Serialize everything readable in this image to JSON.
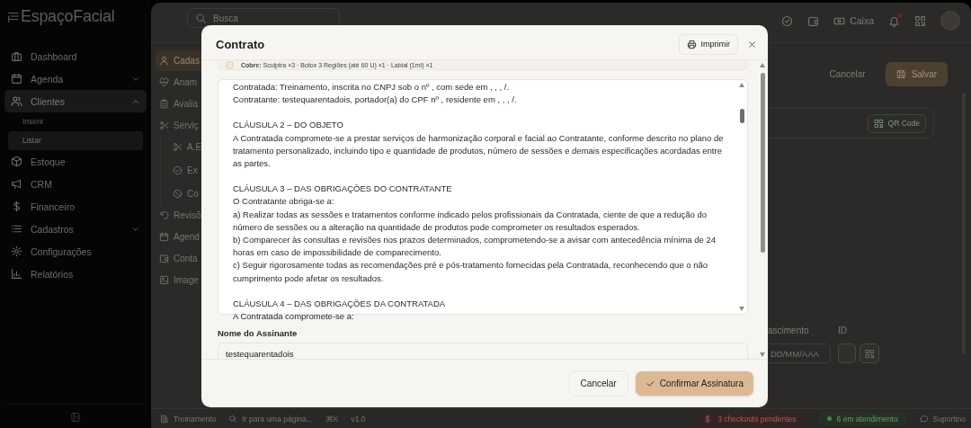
{
  "sidebar": {
    "logo": "EspaçoFacial",
    "items": [
      {
        "label": "Dashboard",
        "selected": false
      },
      {
        "label": "Agenda",
        "selected": false,
        "expanded": false
      },
      {
        "label": "Clientes",
        "selected": true,
        "expanded": true,
        "children": [
          {
            "label": "Inserir",
            "selected": false
          },
          {
            "label": "Listar",
            "selected": true
          }
        ]
      },
      {
        "label": "Estoque",
        "selected": false
      },
      {
        "label": "CRM",
        "selected": false
      },
      {
        "label": "Financeiro",
        "selected": false
      },
      {
        "label": "Cadastros",
        "selected": false,
        "expanded": false
      },
      {
        "label": "Configurações",
        "selected": false
      },
      {
        "label": "Relatórios",
        "selected": false
      }
    ]
  },
  "topbar": {
    "search": {
      "placeholder": "Busca"
    },
    "cash_button": "Caixa",
    "notifications": {
      "unread": true
    }
  },
  "subnav": {
    "items": [
      {
        "label": "Cadas",
        "selected": true
      },
      {
        "label": "Anam",
        "selected": false
      },
      {
        "label": "Avalia",
        "selected": false
      },
      {
        "label": "Serviç",
        "selected": false,
        "children": [
          {
            "label": "A.E",
            "selected": false
          },
          {
            "label": "Ex",
            "selected": false
          },
          {
            "label": "Co",
            "selected": false
          }
        ]
      },
      {
        "label": "Revisõ",
        "selected": false
      },
      {
        "label": "Agend",
        "selected": false
      },
      {
        "label": "Conta",
        "selected": false
      },
      {
        "label": "Image",
        "selected": false
      }
    ]
  },
  "page": {
    "actions": [
      "Cancelar",
      "Salvar"
    ],
    "qr_button": "QR Code",
    "fields": [
      {
        "label": "ascimento",
        "placeholder": "DD/MM/AAA"
      },
      {
        "label": "ID"
      }
    ]
  },
  "status_bar": {
    "workspace": "Treinamento",
    "goto": "Ir para uma página...",
    "shortcut": "⌘K",
    "version": "v1.0",
    "checkouts": "3 checkouts pendentes",
    "attending": "6 em atendimento",
    "support": "Suportino"
  },
  "modal": {
    "title": "Contrato",
    "print_button": "Imprimir",
    "coverage": "**Cobre:** Sculptra ×3 · Botox 3 Regiões (até 60 U) ×1 · Labial (1ml) ×1",
    "contract": [
      [
        "Contratada: Treinamento, inscrita no CNPJ sob o nº , com sede em , , , /.",
        "Contratante: testequarentadois, portador(a) do CPF nº , residente em , , , /."
      ],
      [
        "CLÁUSULA 2 – DO OBJETO",
        "A Contratada compromete-se a prestar serviços de harmonização corporal e facial ao Contratante, conforme descrito no plano de tratamento personalizado, incluindo tipo e quantidade de produtos, número de sessões e demais especificações acordadas entre as partes."
      ],
      [
        "CLÁUSULA 3 – DAS OBRIGAÇÕES DO CONTRATANTE",
        "O Contratante obriga-se a:",
        "a) Realizar todas as sessões e tratamentos conforme indicado pelos profissionais da Contratada, ciente de que a redução do número de sessões ou a alteração na quantidade de produtos pode comprometer os resultados esperados.",
        "b) Comparecer às consultas e revisões nos prazos determinados, comprometendo-se a avisar com antecedência mínima de 24 horas em caso de impossibilidade de comparecimento.",
        "c) Seguir rigorosamente todas as recomendações pré e pós-tratamento fornecidas pela Contratada, reconhecendo que o não cumprimento pode afetar os resultados."
      ],
      [
        "CLÁUSULA 4 – DAS OBRIGAÇÕES DA CONTRATADA",
        "A Contratada compromete-se a:"
      ]
    ],
    "signer": {
      "label": "Nome do Assinante",
      "value": "testequarentadois"
    },
    "buttons": {
      "cancel": "Cancelar",
      "confirm": "Confirmar Assinatura"
    }
  }
}
